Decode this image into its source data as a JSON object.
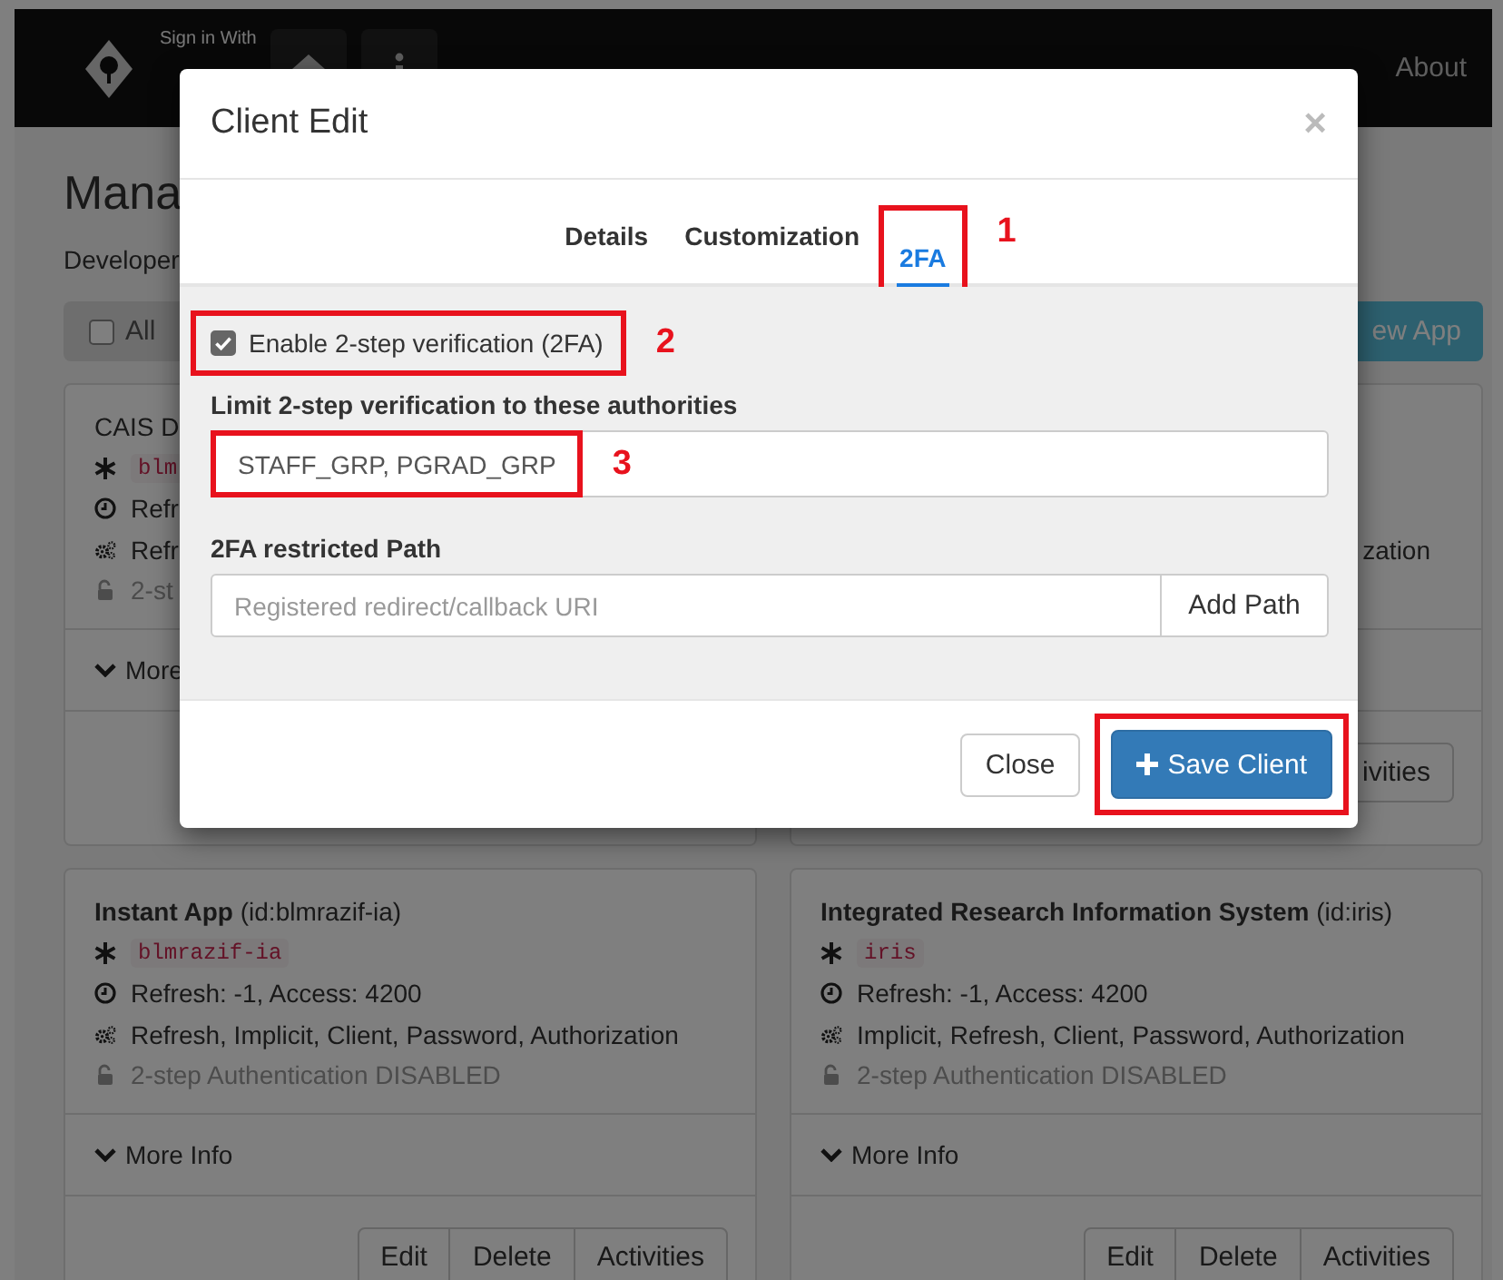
{
  "navbar": {
    "sign_in_label": "Sign in With",
    "links": [
      "About"
    ]
  },
  "page": {
    "title": "Mana",
    "subtitle": "Developer",
    "select_all": {
      "label": "All",
      "checked": false
    },
    "new_app_button": "ew App"
  },
  "cards": [
    {
      "kind": "left_part",
      "title": "CAIS D",
      "client_id": "blm",
      "tokens": "Refr",
      "grants": "Refr",
      "two_factor": "2-st",
      "more_info": "More"
    },
    {
      "kind": "right_part",
      "grants": "zation",
      "actions": [
        "ivities"
      ]
    },
    {
      "kind": "full",
      "title": "**Instant App** (id:blmrazif-ia)",
      "client_id": "blmrazif-ia",
      "tokens": "Refresh: -1, Access: 4200",
      "grants": "Refresh, Implicit, Client, Password, Authorization",
      "two_factor": "2-step Authentication DISABLED",
      "more_info": "More Info",
      "actions": [
        "Edit",
        "Delete",
        "Activities"
      ]
    },
    {
      "kind": "full",
      "title": "**Integrated Research Information System** (id:iris)",
      "client_id": "iris",
      "tokens": "Refresh: -1, Access: 4200",
      "grants": "Implicit, Refresh, Client, Password, Authorization",
      "two_factor": "2-step Authentication DISABLED",
      "more_info": "More Info",
      "actions": [
        "Edit",
        "Delete",
        "Activities"
      ]
    }
  ],
  "modal": {
    "title": "Client Edit",
    "close": "×",
    "tabs": [
      {
        "label": "Details",
        "selected": false
      },
      {
        "label": "Customization",
        "selected": false
      },
      {
        "label": "2FA",
        "selected": true,
        "annotation": "1"
      }
    ],
    "enable_2fa": {
      "label": "Enable 2-step verification (2FA)",
      "checked": true,
      "annotation": "2"
    },
    "authorities": {
      "label": "Limit 2-step verification to these authorities",
      "value": "STAFF_GRP, PGRAD_GRP",
      "annotation": "3"
    },
    "restricted_path": {
      "label": "2FA restricted Path",
      "placeholder": "Registered redirect/callback URI",
      "button": "Add Path"
    },
    "buttons": [
      {
        "label": "Close",
        "kind": "default",
        "highlighted": false
      },
      {
        "label": "Save Client",
        "kind": "primary",
        "highlighted": true
      }
    ]
  }
}
